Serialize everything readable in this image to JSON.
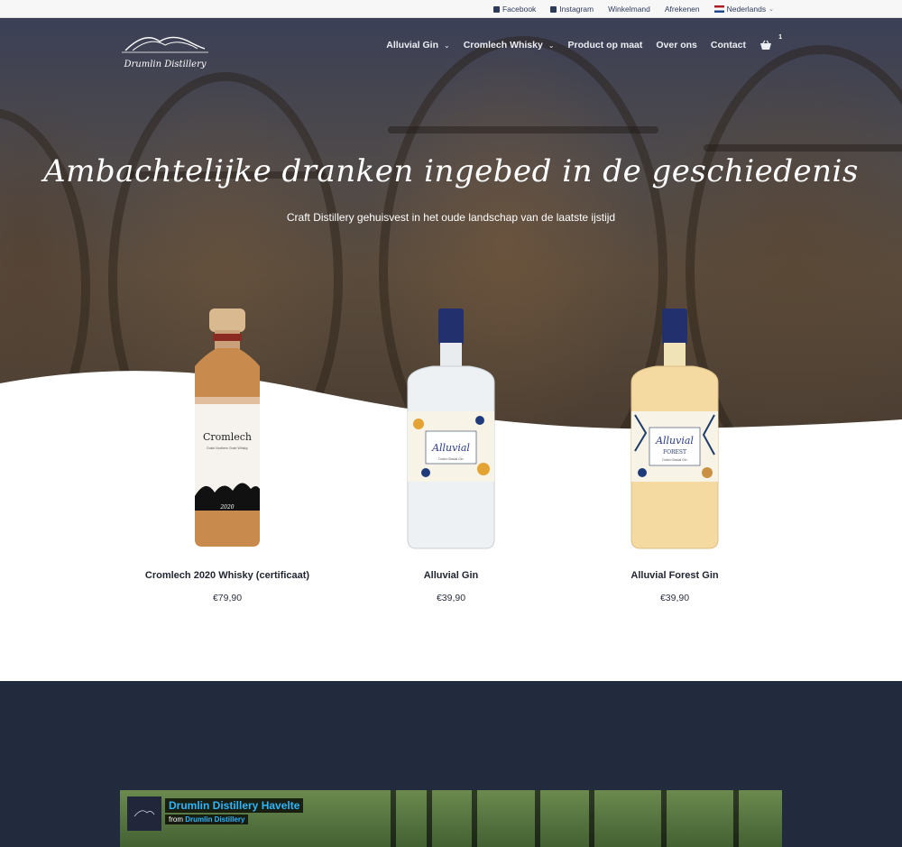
{
  "topbar": {
    "links": [
      {
        "label": "Facebook",
        "icon": "facebook-icon"
      },
      {
        "label": "Instagram",
        "icon": "instagram-icon"
      },
      {
        "label": "Winkelmand"
      },
      {
        "label": "Afrekenen"
      },
      {
        "label": "Nederlands",
        "icon": "dutch-flag-icon"
      }
    ]
  },
  "brand": {
    "name": "Drumlin Distillery"
  },
  "nav": {
    "items": [
      {
        "label": "Alluvial Gin",
        "dropdown": true
      },
      {
        "label": "Cromlech Whisky",
        "dropdown": true
      },
      {
        "label": "Product op maat",
        "dropdown": false
      },
      {
        "label": "Over ons",
        "dropdown": false
      },
      {
        "label": "Contact",
        "dropdown": false
      }
    ],
    "cart_count": "1"
  },
  "hero": {
    "title": "Ambachtelijke dranken ingebed in de geschiedenis",
    "subtitle": "Craft Distillery gehuisvest in het oude landschap van de laatste ijstijd"
  },
  "products": [
    {
      "name": "Cromlech 2020 Whisky (certificaat)",
      "price": "€79,90",
      "label_text": "Cromlech",
      "label_sub": "Dutch Northern Grain Whisky",
      "year": "2020"
    },
    {
      "name": "Alluvial Gin",
      "price": "€39,90",
      "label_text": "Alluvial",
      "label_sub": "Dutch Glacial Gin"
    },
    {
      "name": "Alluvial Forest Gin",
      "price": "€39,90",
      "label_text": "Alluvial",
      "label_sub2": "FOREST",
      "label_sub": "Dutch Glacial Gin"
    }
  ],
  "video": {
    "title": "Drumlin Distillery Havelte",
    "from_prefix": "from",
    "from_channel": "Drumlin Distillery"
  },
  "colors": {
    "dark_band": "#222a3e",
    "accent_blue": "#2fb4ff",
    "nav_text": "#2d3a5a"
  }
}
